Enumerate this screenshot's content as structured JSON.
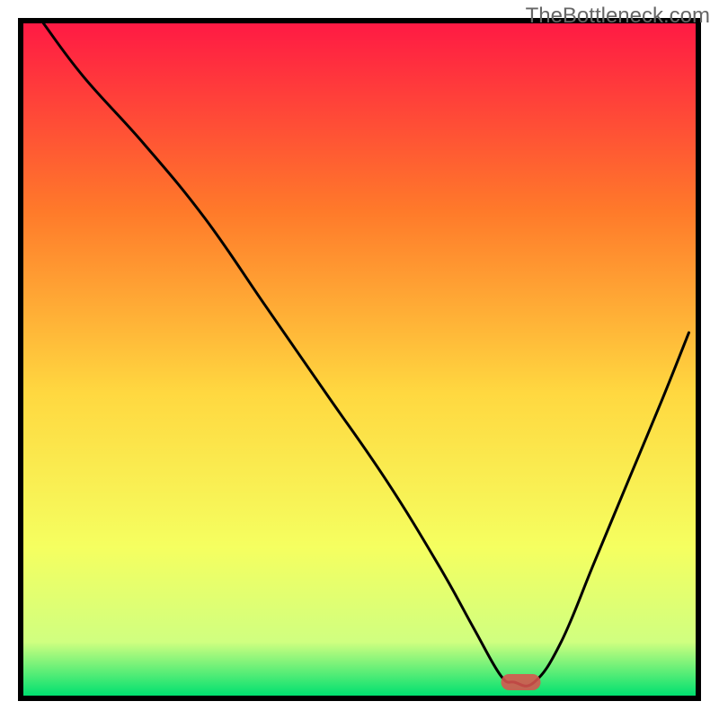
{
  "watermark": "TheBottleneck.com",
  "chart_data": {
    "type": "line",
    "title": "",
    "xlabel": "",
    "ylabel": "",
    "xlim": [
      0,
      100
    ],
    "ylim": [
      0,
      100
    ],
    "gradient": {
      "top_color": "#ff1a44",
      "upper_mid_color": "#ff7a2a",
      "mid_color": "#ffd840",
      "lower_mid_color": "#f5ff60",
      "near_bottom_color": "#d0ff80",
      "bottom_color": "#00e070"
    },
    "series": [
      {
        "name": "bottleneck-curve",
        "x": [
          3,
          9,
          18,
          27,
          36,
          45,
          54,
          62,
          67,
          71,
          73,
          76,
          80,
          85,
          90,
          95,
          99
        ],
        "y": [
          100,
          92,
          82,
          71,
          58,
          45,
          32,
          19,
          10,
          3,
          2,
          2,
          8,
          20,
          32,
          44,
          54
        ]
      }
    ],
    "marker": {
      "name": "recommended-point",
      "x": 74,
      "y": 2,
      "color": "#d9534f"
    },
    "frame": {
      "color": "#000000",
      "thickness": 6
    }
  }
}
